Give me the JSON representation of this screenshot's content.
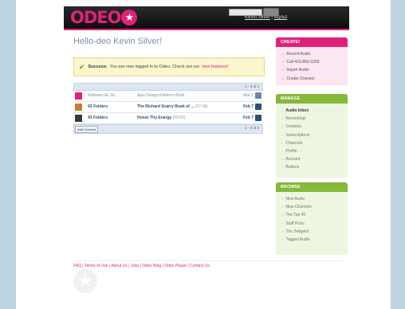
{
  "header": {
    "logo_text": "ODEO",
    "logo_star": "★",
    "user_link": "Kevin Silver",
    "separator": "|",
    "logout_link": "logout",
    "search_button": "search"
  },
  "greeting": "Hello-deo Kevin Silver!",
  "success": {
    "icon": "✔",
    "label": "Success:",
    "message": "You are now logged in to Odeo. Check out our",
    "link": "new features!"
  },
  "table": {
    "pager_top": "1 - 3 of 3",
    "rows": [
      {
        "c1": "Software As Sli...",
        "c2": "Ajax Design Patterns Book",
        "c3": "Mar 1",
        "thumb_color": "#e0217a"
      },
      {
        "c1": "43 Folders",
        "c2": "The Richard Scarry Book of ...",
        "dur": "(07:48)",
        "c3": "Feb 7",
        "thumb_color": "#c77d3a"
      },
      {
        "c1": "43 Folders",
        "c2": "Honor Thy Energy",
        "dur": "(09:56)",
        "c3": "Feb 7",
        "thumb_color": "#3a3a3a"
      }
    ],
    "add_button": "Add Channel",
    "pager_bottom": "1 - 3 of 3"
  },
  "sidebar": {
    "create": {
      "title": "CREATE!",
      "items": [
        "Record Audio",
        "Call 415-856-0205",
        "Import Audio",
        "Create Channel"
      ]
    },
    "manage": {
      "title": "MANAGE",
      "items": [
        "Audio Inbox",
        "Recordings",
        "Contacts",
        "Subscriptions",
        "Channels",
        "Profile",
        "Account",
        "Buttons"
      ]
    },
    "browse": {
      "title": "BROWSE",
      "items": [
        "New Audio",
        "New Channels",
        "The Top 40",
        "Staff Picks",
        "The Zeitgeist",
        "Tagged Audio"
      ]
    }
  },
  "footer": {
    "links": "FAQ | Terms of Use | About Us | Jobs | Odeo Blog | Odeo Player | Contact Us"
  },
  "colors": {
    "brand_pink": "#e0217a",
    "brand_green": "#86b83a",
    "link_blue": "#2a4f7a"
  }
}
